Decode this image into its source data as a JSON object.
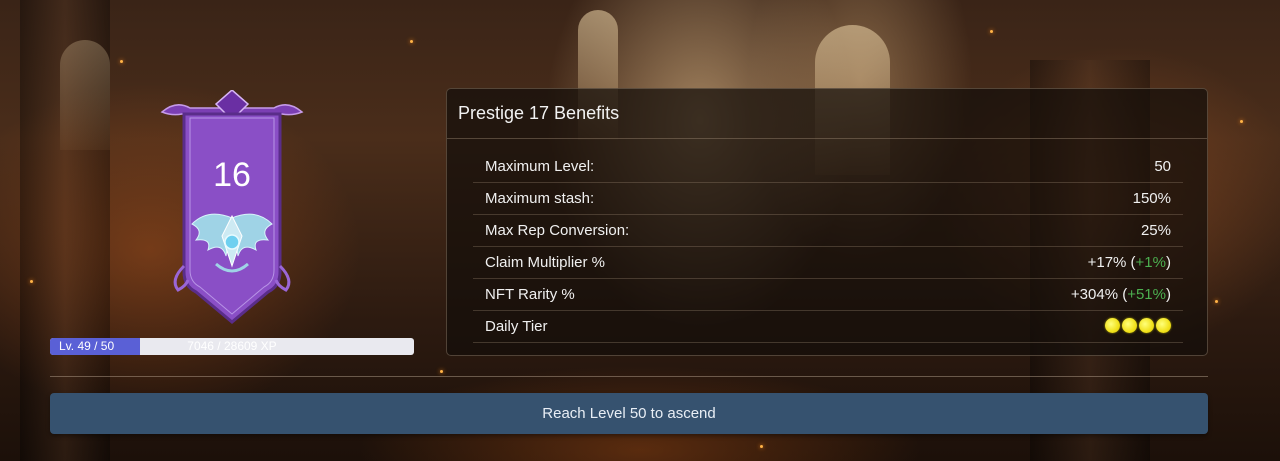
{
  "prestige": {
    "current_level": "16",
    "banner_icon": "winged-crest-icon"
  },
  "xp": {
    "level_text": "Lv. 49 / 50",
    "points_text": "7046 / 28609 XP",
    "progress_fraction": 0.2463
  },
  "benefits": {
    "title": "Prestige 17 Benefits",
    "rows": [
      {
        "label": "Maximum Level:",
        "value": "50"
      },
      {
        "label": "Maximum stash:",
        "value": "150%"
      },
      {
        "label": "Max Rep Conversion:",
        "value": "25%"
      },
      {
        "label": "Claim Multiplier %",
        "value": "+17% (",
        "bonus": "+1%",
        "close": ")"
      },
      {
        "label": "NFT Rarity %",
        "value": "+304% (",
        "bonus": "+51%",
        "close": ")"
      },
      {
        "label": "Daily Tier",
        "stars": 4,
        "star_icon": "flower-star-icon"
      }
    ]
  },
  "actions": {
    "ascend_label": "Reach Level 50 to ascend"
  },
  "colors": {
    "bonus_green": "#4caf50",
    "xp_fill": "#5a60d6",
    "button_bg": "#36526f",
    "banner_purple": "#8a4fc6"
  }
}
